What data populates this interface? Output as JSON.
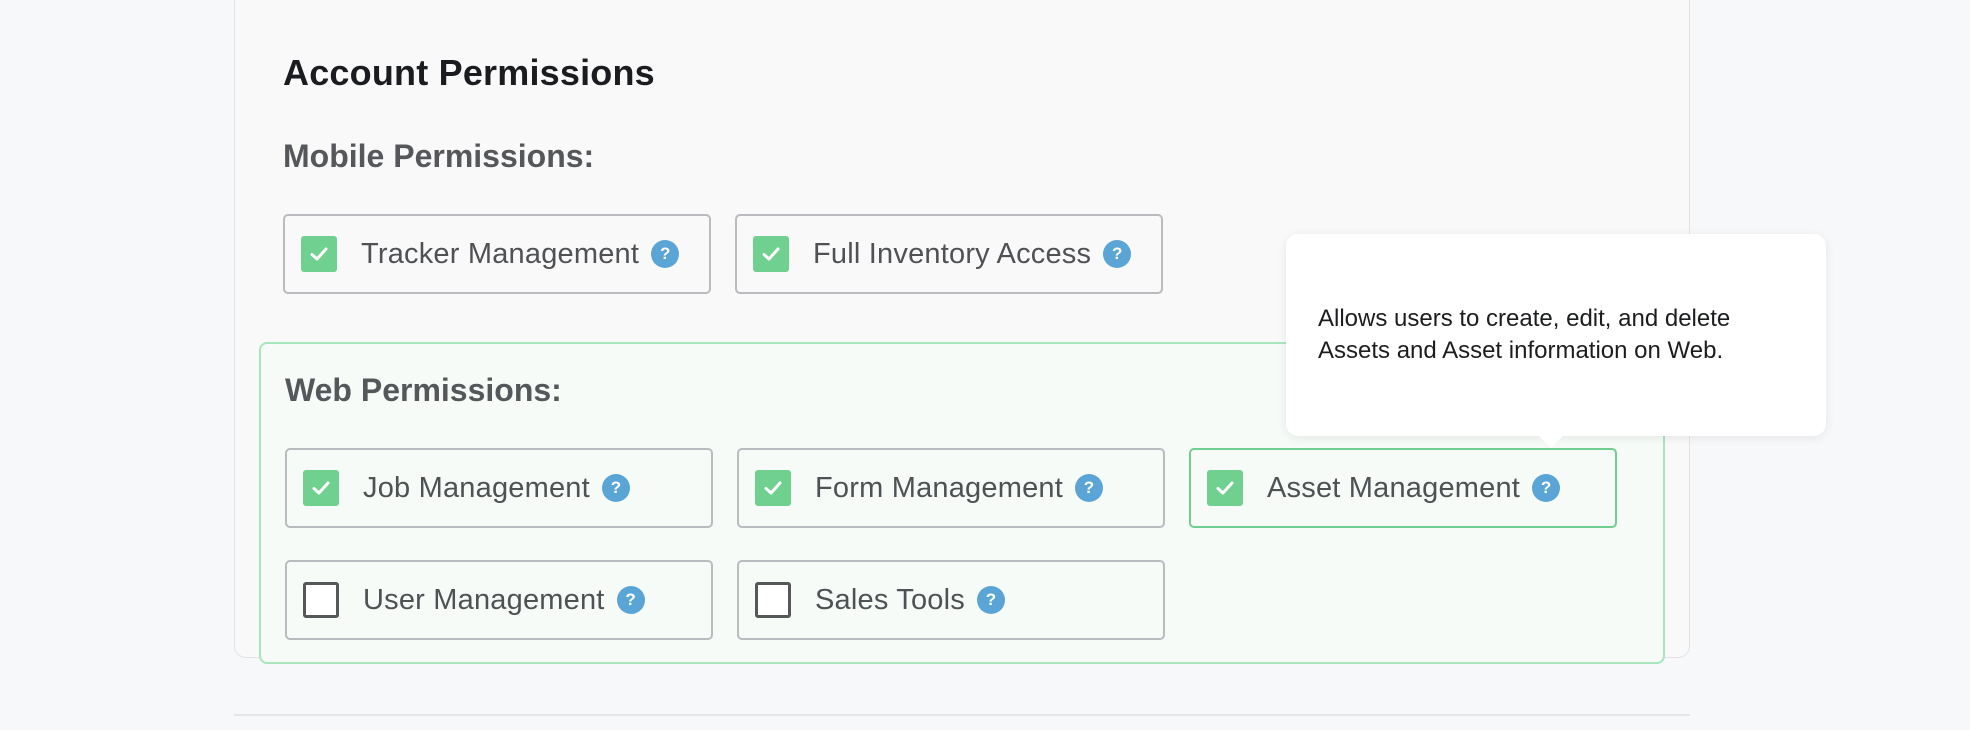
{
  "title": "Account Permissions",
  "mobile": {
    "heading": "Mobile Permissions:",
    "items": [
      {
        "label": "Tracker Management",
        "checked": true
      },
      {
        "label": "Full Inventory Access",
        "checked": true
      }
    ]
  },
  "web": {
    "heading": "Web Permissions:",
    "items": [
      {
        "label": "Job Management",
        "checked": true
      },
      {
        "label": "Form Management",
        "checked": true
      },
      {
        "label": "Asset Management",
        "checked": true
      },
      {
        "label": "User Management",
        "checked": false
      },
      {
        "label": "Sales Tools",
        "checked": false
      }
    ]
  },
  "help_glyph": "?",
  "tooltip": {
    "text": "Allows users to create, edit, and delete Assets and Asset information on Web."
  },
  "colors": {
    "checked": "#6fd090",
    "help": "#5aa5d6",
    "active_border": "#6fcf92"
  }
}
